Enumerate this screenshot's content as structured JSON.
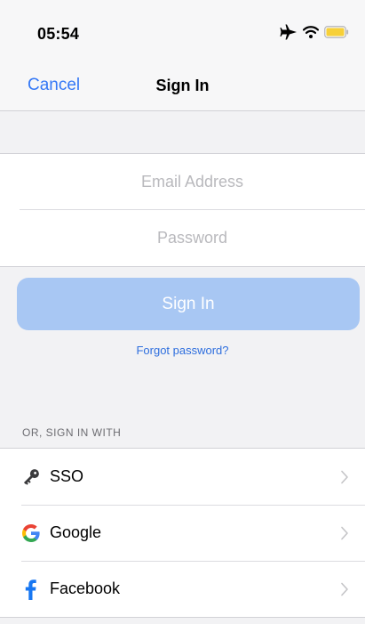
{
  "status_bar": {
    "time": "05:54",
    "icons": [
      "airplane-icon",
      "wifi-icon",
      "battery-icon"
    ],
    "battery_color": "#f7d038"
  },
  "nav": {
    "cancel_label": "Cancel",
    "title": "Sign In"
  },
  "form": {
    "email_placeholder": "Email Address",
    "password_placeholder": "Password"
  },
  "sign_in_button_label": "Sign In",
  "forgot_password_label": "Forgot password?",
  "alt_section_header": "OR, SIGN IN WITH",
  "providers": [
    {
      "label": "SSO",
      "icon": "key-icon"
    },
    {
      "label": "Google",
      "icon": "google-icon"
    },
    {
      "label": "Facebook",
      "icon": "facebook-icon"
    }
  ],
  "colors": {
    "accent": "#3478f6",
    "button_disabled": "#a8c7f3",
    "google_blue": "#4285f4",
    "google_red": "#ea4335",
    "google_yellow": "#fbbc05",
    "google_green": "#34a853",
    "facebook_blue": "#1877f2"
  }
}
